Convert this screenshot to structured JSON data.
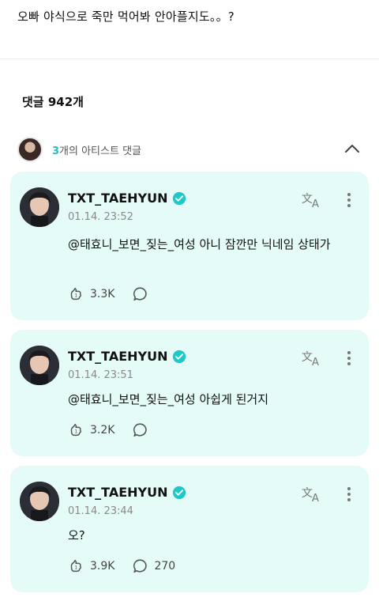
{
  "post": {
    "text": "오빠 야식으로 죽만 먹어봐 안아플지도。。?"
  },
  "comments_header": {
    "count_label": "댓글 942개"
  },
  "artist_row": {
    "count": "3",
    "label": "개의 아티스트 댓글"
  },
  "comments": [
    {
      "name": "TXT_TAEHYUN",
      "time": "01.14. 23:52",
      "text": "@태효니_보면_짖는_여성 아니 잠깐만 닉네임 상태가",
      "likes": "3.3K",
      "replies": ""
    },
    {
      "name": "TXT_TAEHYUN",
      "time": "01.14. 23:51",
      "text": "@태효니_보면_짖는_여성 아쉽게 된거지",
      "likes": "3.2K",
      "replies": ""
    },
    {
      "name": "TXT_TAEHYUN",
      "time": "01.14. 23:44",
      "text": "오?",
      "likes": "3.9K",
      "replies": "270"
    }
  ],
  "colors": {
    "card_bg": "#e5fbf8",
    "accent": "#19c2c2",
    "verified": "#1fc7c7"
  },
  "icons": [
    "translate-icon",
    "more-vertical-icon",
    "cheer-icon",
    "comment-bubble-icon",
    "verified-badge-icon",
    "chevron-up-icon"
  ]
}
